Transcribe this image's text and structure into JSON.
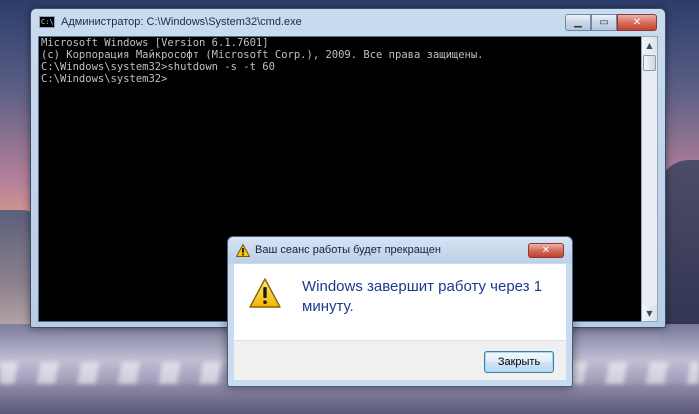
{
  "cmd_window": {
    "title": "Администратор: C:\\Windows\\System32\\cmd.exe",
    "app_icon_text": "C:\\",
    "console_lines": [
      "Microsoft Windows [Version 6.1.7601]",
      "(c) Корпорация Майкрософт (Microsoft Corp.), 2009. Все права защищены.",
      "",
      "C:\\Windows\\system32>shutdown -s -t 60",
      "",
      "C:\\Windows\\system32>"
    ],
    "buttons": {
      "minimize_glyph": "▁",
      "maximize_glyph": "▭",
      "close_glyph": "✕"
    },
    "scrollbar": {
      "up_glyph": "▲",
      "down_glyph": "▼"
    }
  },
  "dialog": {
    "title": "Ваш сеанс работы будет прекращен",
    "message": "Windows завершит работу через 1 минуту.",
    "button_label": "Закрыть",
    "close_glyph": "✕",
    "icon": "warning-icon"
  },
  "colors": {
    "console_bg": "#000000",
    "console_text": "#c0c0c0",
    "message_text": "#1d3b8c",
    "warning_yellow": "#f5c516"
  }
}
